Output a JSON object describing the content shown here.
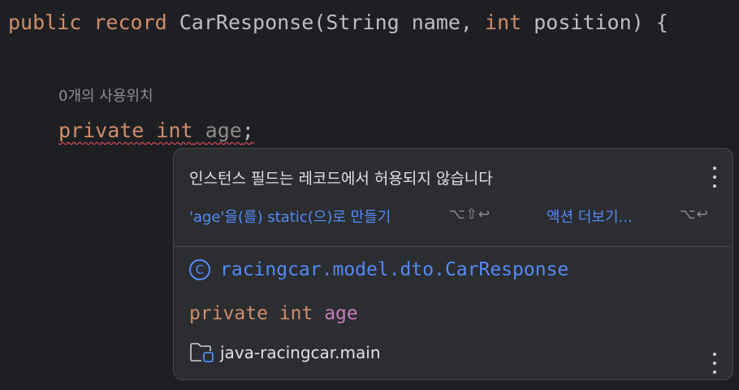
{
  "editor": {
    "line1": {
      "kw_public": "public",
      "kw_record": "record",
      "class_name": "CarResponse(String name, ",
      "kw_int": "int",
      "rest": " position) {"
    },
    "usages_hint": "0개의 사용위치",
    "line2": {
      "kw_private": "private",
      "kw_int": "int",
      "field": "age",
      "semicolon": ";"
    }
  },
  "popup": {
    "title": "인스턴스 필드는 레코드에서 허용되지 않습니다",
    "primary_action": "'age'을(를) static(으)로 만들기",
    "primary_shortcut": "⌥⇧↩",
    "more_actions": "액션 더보기...",
    "more_shortcut": "⌥↩",
    "class_icon": "class-icon",
    "class_icon_glyph": "C",
    "qualified_class": "racingcar.model.dto.CarResponse",
    "decl": {
      "kw_private": "private",
      "kw_int": "int",
      "field": "age"
    },
    "module_icon": "folder-icon",
    "module": "java-racingcar.main"
  },
  "colors": {
    "editor_bg": "#1e1f22",
    "keyword": "#cf8e6d",
    "plain_text": "#bcbec4",
    "unused_field": "#8c8c8c",
    "error_squiggle": "#f75464",
    "popup_bg": "#2b2d30",
    "link": "#548af7",
    "field_purple": "#c77dbb"
  }
}
